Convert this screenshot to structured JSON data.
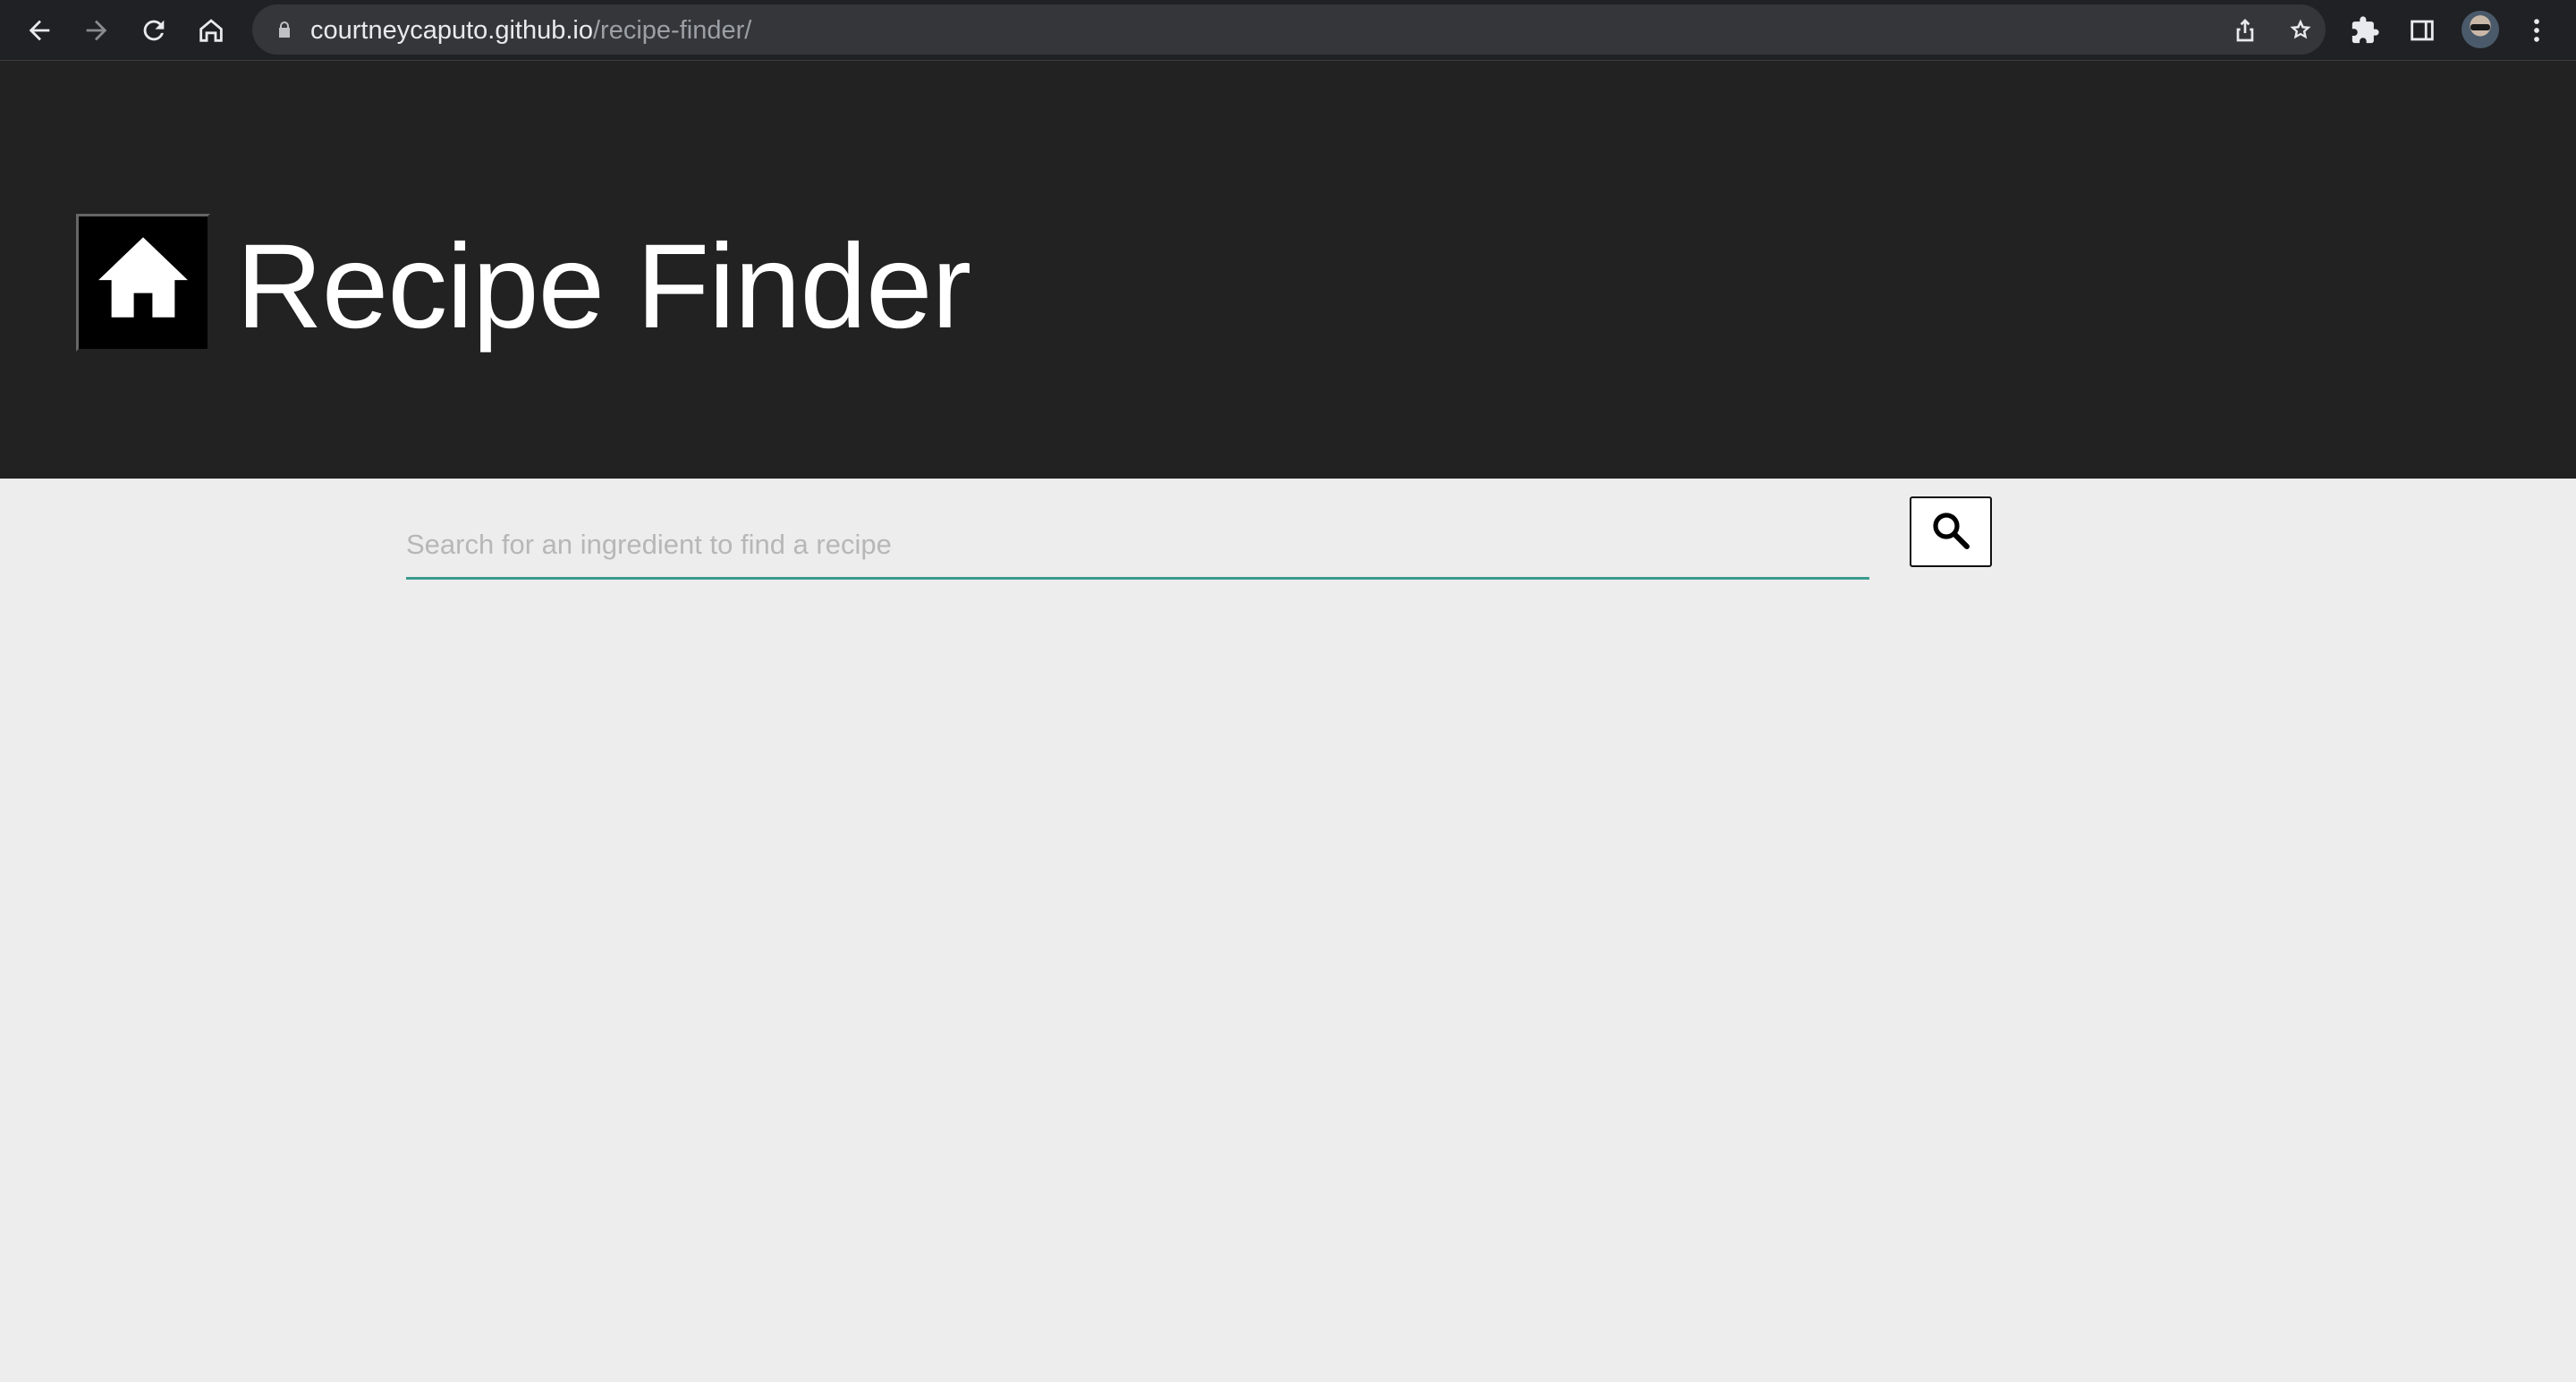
{
  "browser": {
    "url_host": "courtneycaputo.github.io",
    "url_path": "/recipe-finder/",
    "icons": {
      "back": "back-arrow-icon",
      "forward": "forward-arrow-icon",
      "reload": "reload-icon",
      "home": "home-icon",
      "lock": "lock-icon",
      "share": "share-icon",
      "bookmark": "star-icon",
      "extensions": "puzzle-icon",
      "side_panel": "side-panel-icon",
      "profile": "avatar",
      "menu": "kebab-menu-icon"
    }
  },
  "header": {
    "home_icon": "home-icon",
    "title": "Recipe Finder",
    "background_color": "#222222"
  },
  "search": {
    "placeholder": "Search for an ingredient to find a recipe",
    "value": "",
    "button_icon": "magnifier-icon",
    "underline_color": "#3d9b8f"
  },
  "page": {
    "background_color": "#ededed"
  }
}
